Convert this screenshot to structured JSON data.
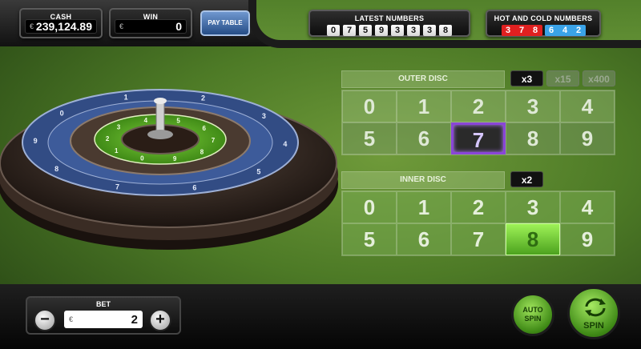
{
  "top": {
    "cash_label": "CASH",
    "cash_currency": "€",
    "cash_value": "239,124.89",
    "win_label": "WIN",
    "win_currency": "€",
    "win_value": "0",
    "paytable_label": "PAY TABLE",
    "latest_title": "LATEST NUMBERS",
    "latest_numbers": [
      "0",
      "7",
      "5",
      "9",
      "3",
      "3",
      "3",
      "8"
    ],
    "hot_cold_title": "HOT AND COLD NUMBERS",
    "hot_numbers": [
      "3",
      "7",
      "8"
    ],
    "cold_numbers": [
      "6",
      "4",
      "2"
    ]
  },
  "wheel": {
    "outer_numbers": [
      "2",
      "3",
      "4",
      "5",
      "6",
      "7",
      "8",
      "9",
      "0",
      "1"
    ],
    "inner_numbers": [
      "5",
      "6",
      "7",
      "8",
      "9",
      "0",
      "1",
      "2",
      "3",
      "4"
    ]
  },
  "outer_disc": {
    "title": "OUTER DISC",
    "multipliers": [
      "x3",
      "x15",
      "x400"
    ],
    "active_multiplier": "x3",
    "numbers": [
      "0",
      "1",
      "2",
      "3",
      "4",
      "5",
      "6",
      "7",
      "8",
      "9"
    ],
    "selected": "7"
  },
  "inner_disc": {
    "title": "INNER DISC",
    "multipliers": [
      "x2"
    ],
    "numbers": [
      "0",
      "1",
      "2",
      "3",
      "4",
      "5",
      "6",
      "7",
      "8",
      "9"
    ],
    "selected": "8"
  },
  "bottom": {
    "bet_label": "BET",
    "bet_currency": "€",
    "bet_value": "2",
    "minus_label": "−",
    "plus_label": "+",
    "auto_spin_label": "AUTO\nSPIN",
    "spin_label": "SPIN"
  },
  "colors": {
    "felt_green": "#5f8d33",
    "hot_red": "#e02020",
    "cold_blue": "#3aa3e8",
    "selected_purple": "#8a45d8",
    "selected_green": "#7fd83a"
  }
}
